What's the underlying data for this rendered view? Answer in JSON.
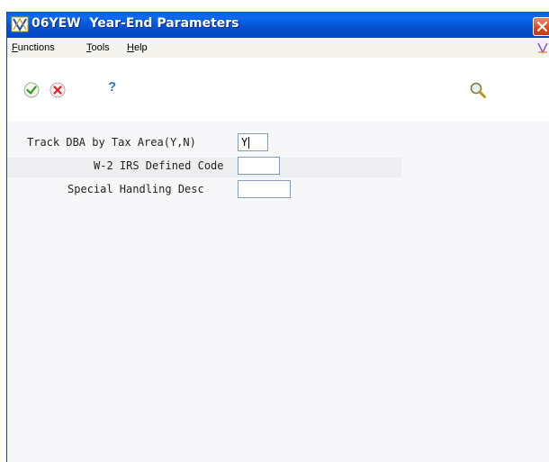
{
  "window": {
    "title_code": "06YEW",
    "title_text": "Year-End Parameters"
  },
  "menu": {
    "functions": {
      "mnemonic": "F",
      "rest": "unctions"
    },
    "tools": {
      "mnemonic": "T",
      "rest": "ools"
    },
    "help": {
      "mnemonic": "H",
      "rest": "elp"
    }
  },
  "toolbar": {
    "ok": "checkmark-icon",
    "cancel": "cancel-icon",
    "help": "?",
    "search": "magnifier-icon"
  },
  "form": {
    "fields": [
      {
        "label": "Track DBA by Tax Area(Y,N)",
        "value": "Y"
      },
      {
        "label": "W-2 IRS Defined Code",
        "value": ""
      },
      {
        "label": "Special Handling Desc",
        "value": ""
      }
    ]
  },
  "colors": {
    "titlebar": "#0454d3",
    "close": "#d9461e",
    "form_bg": "#f7f7f9"
  }
}
